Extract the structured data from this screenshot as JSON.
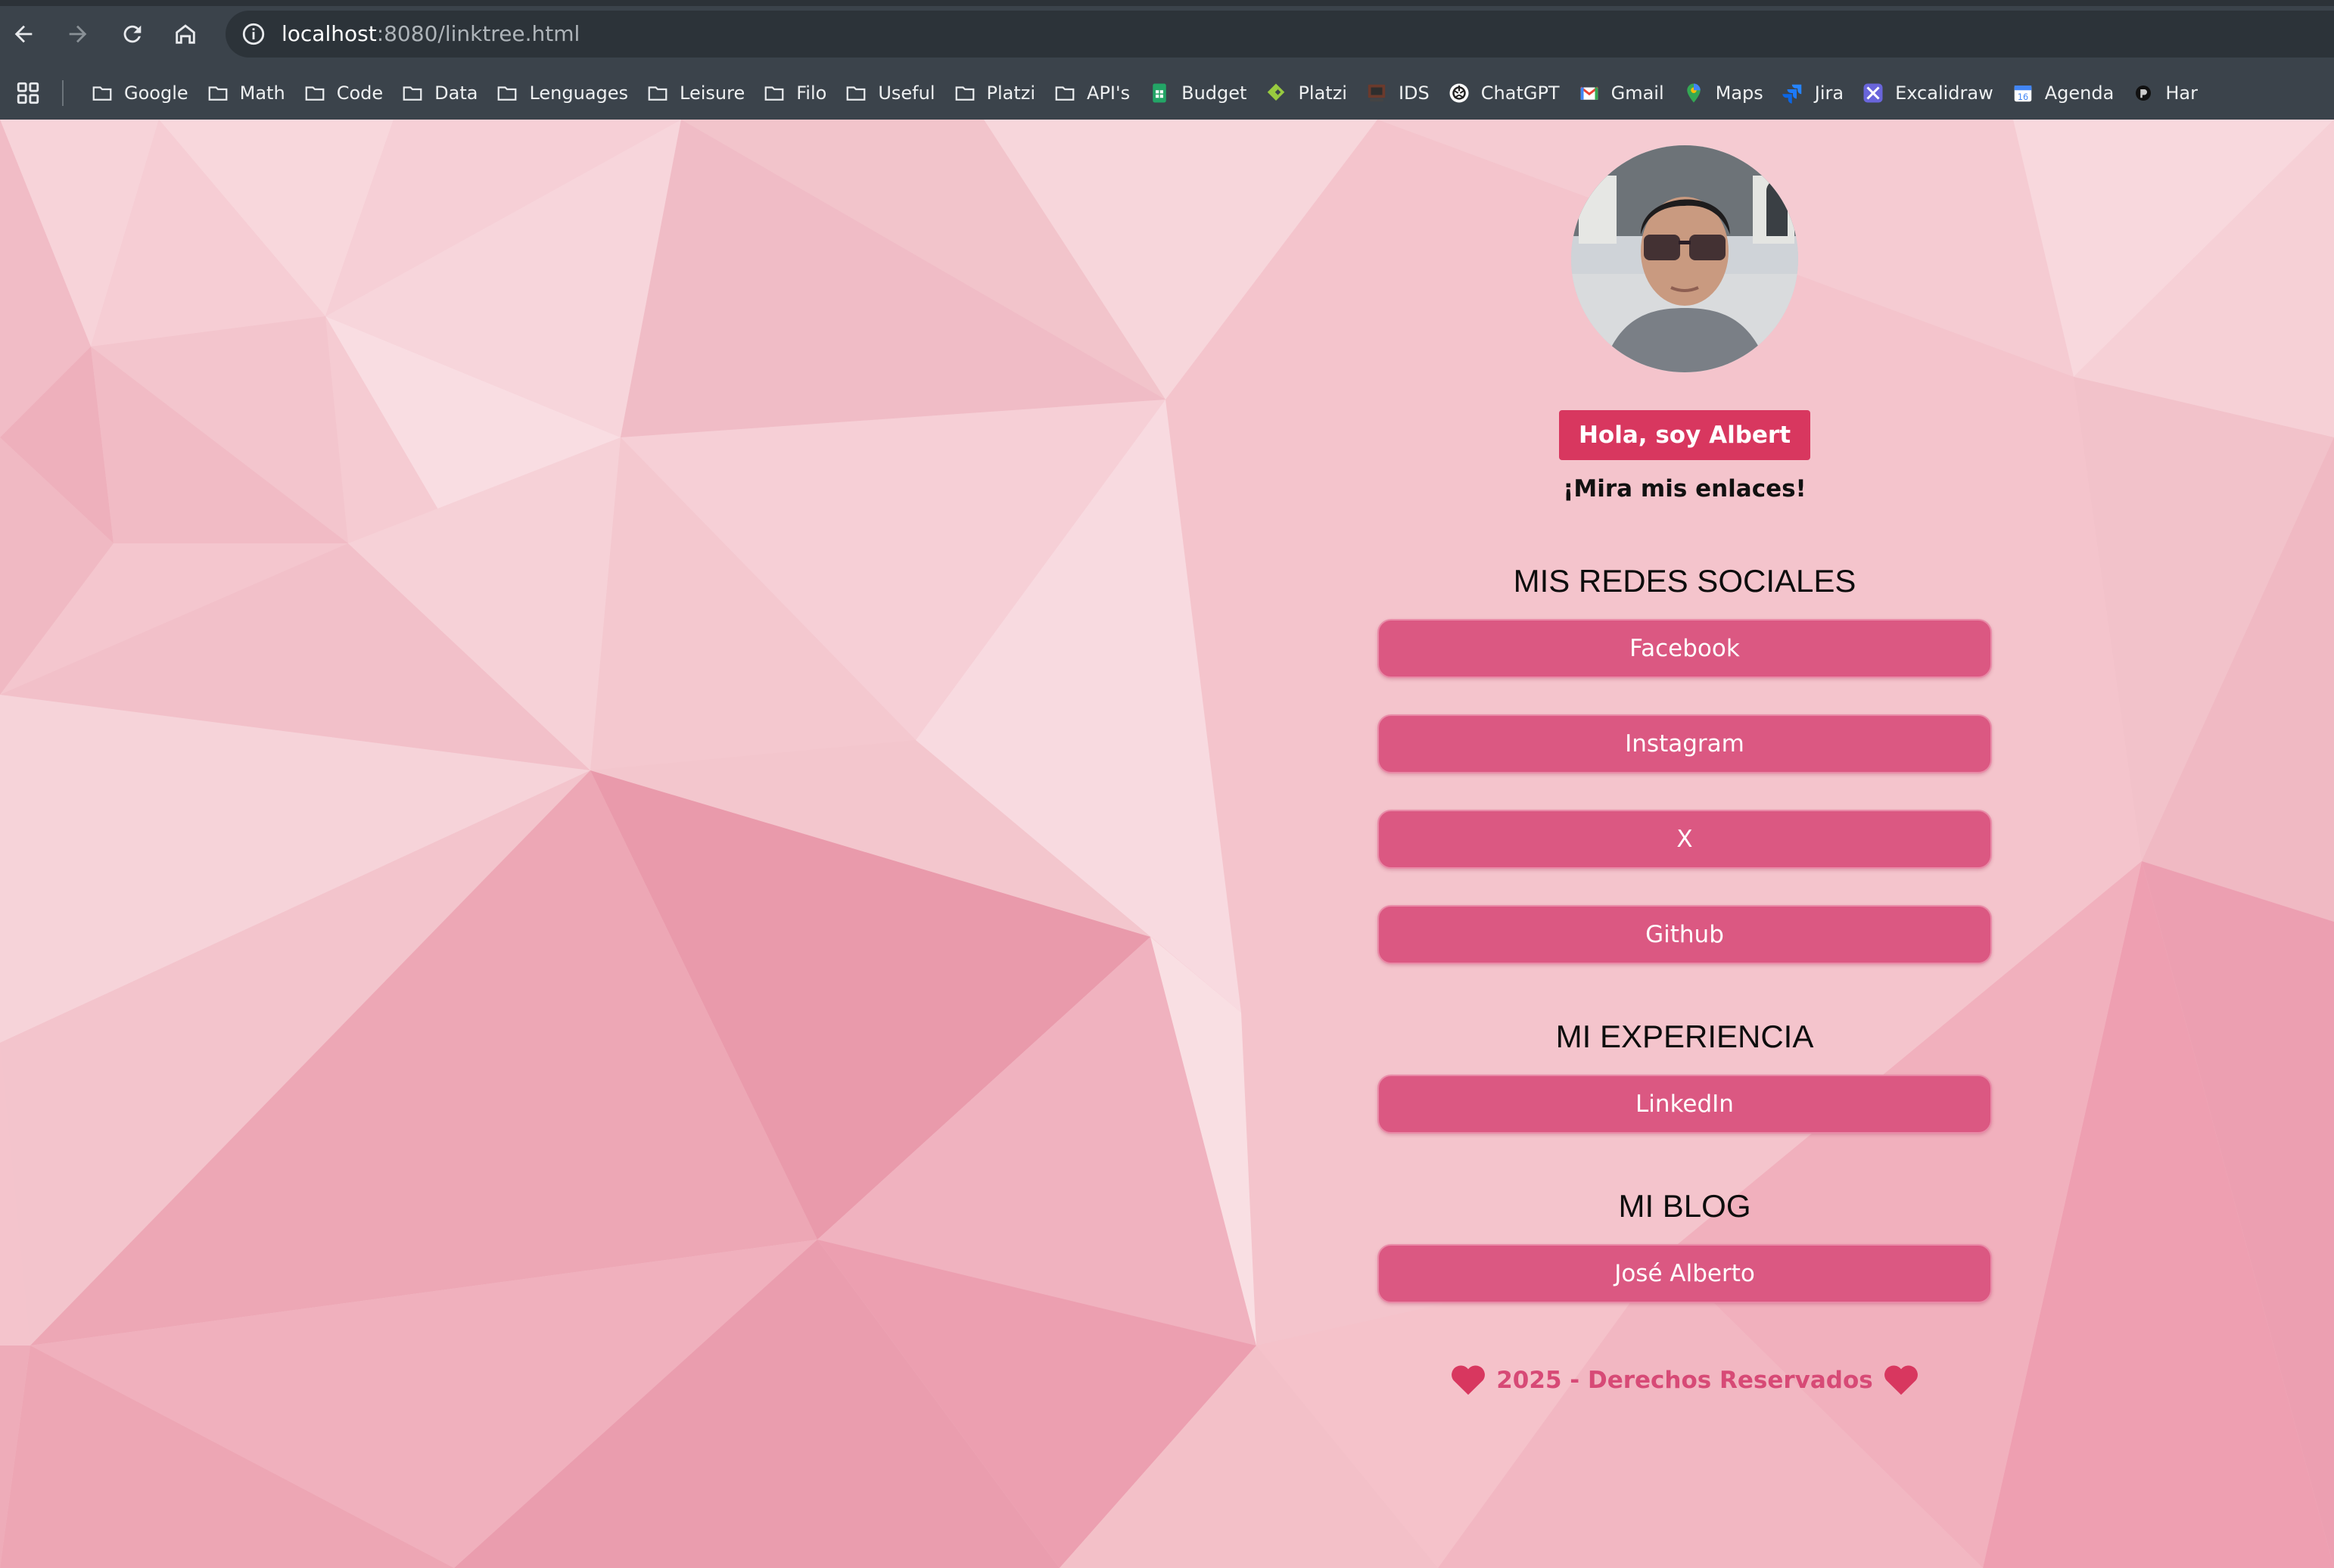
{
  "browser": {
    "url_host": "localhost",
    "url_path": ":8080/linktree.html",
    "nav": {
      "back_icon": "arrow-left-icon",
      "forward_icon": "arrow-right-icon",
      "reload_icon": "reload-icon",
      "home_icon": "home-icon",
      "site_info_icon": "info-icon"
    },
    "bookmarks": [
      {
        "label": "Google",
        "icon": "folder-icon"
      },
      {
        "label": "Math",
        "icon": "folder-icon"
      },
      {
        "label": "Code",
        "icon": "folder-icon"
      },
      {
        "label": "Data",
        "icon": "folder-icon"
      },
      {
        "label": "Lenguages",
        "icon": "folder-icon"
      },
      {
        "label": "Leisure",
        "icon": "folder-icon"
      },
      {
        "label": "Filo",
        "icon": "folder-icon"
      },
      {
        "label": "Useful",
        "icon": "folder-icon"
      },
      {
        "label": "Platzi",
        "icon": "folder-icon"
      },
      {
        "label": "API's",
        "icon": "folder-icon"
      },
      {
        "label": "Budget",
        "icon": "sheets-icon"
      },
      {
        "label": "Platzi",
        "icon": "platzi-icon"
      },
      {
        "label": "IDS",
        "icon": "ids-icon"
      },
      {
        "label": "ChatGPT",
        "icon": "chatgpt-icon"
      },
      {
        "label": "Gmail",
        "icon": "gmail-icon"
      },
      {
        "label": "Maps",
        "icon": "maps-icon"
      },
      {
        "label": "Jira",
        "icon": "jira-icon"
      },
      {
        "label": "Excalidraw",
        "icon": "excalidraw-icon"
      },
      {
        "label": "Agenda",
        "icon": "calendar-icon"
      },
      {
        "label": "Har",
        "icon": "site-icon"
      }
    ]
  },
  "profile": {
    "avatar_icon": "profile-photo",
    "greeting": "Hola, soy Albert",
    "subtitle": "¡Mira mis enlaces!"
  },
  "sections": {
    "social": {
      "title": "MIS REDES SOCIALES",
      "links": [
        "Facebook",
        "Instagram",
        "X",
        "Github"
      ]
    },
    "experience": {
      "title": "MI EXPERIENCIA",
      "links": [
        "LinkedIn"
      ]
    },
    "blog": {
      "title": "MI BLOG",
      "links": [
        "José Alberto"
      ]
    }
  },
  "footer": {
    "text": "2025 - Derechos Reservados",
    "icon": "heart-icon"
  },
  "colors": {
    "accent": "#d8375f",
    "button": "#db5882",
    "footer_text": "#d74a76",
    "chrome": "#3b434b"
  }
}
